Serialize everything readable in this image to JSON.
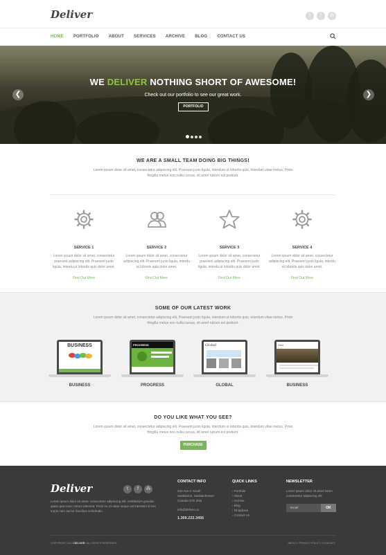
{
  "brand": {
    "logo": "Deliver",
    "accent": "#7ab55c"
  },
  "social_icons": [
    "twitter-icon",
    "facebook-icon",
    "rss-icon"
  ],
  "nav": {
    "items": [
      "HOME",
      "PORTFOLIO",
      "ABOUT",
      "SERVICES",
      "ARCHIVE",
      "BLOG",
      "CONTACT US"
    ],
    "active": "HOME"
  },
  "hero": {
    "title_pre": "WE",
    "title_accent": "DELIVER",
    "title_post": "NOTHING SHORT OF AWESOME!",
    "subtitle": "Check out our portfolio to see our great work.",
    "button": "PORTFOLIO",
    "prev": "❮",
    "next": "❯",
    "slide_count": 4,
    "current_slide": 1
  },
  "intro": {
    "title": "WE ARE A SMALL TEAM DOING BIG THINGS!",
    "text": "Lorem ipsum dolor sit amet, consectetur adipiscing elit. Praesent justo ligula, interdum ut lobortis quis, interdum vitae metus. Proin fringilla metus non nulla cursus, sit amet rutrum est pretium."
  },
  "services": [
    {
      "title": "SERVICE 1",
      "icon": "gear-icon",
      "text": "Lorem ipsum dolor sit amet, consectetur praesent adipiscing elit. Praesent justo ligula, interdu ut lobortis quis dolor amet.",
      "link": "Find Out More"
    },
    {
      "title": "SERVICE 2",
      "icon": "users-icon",
      "text": "Lorem ipsum dolor sit amet, consectetur adipiscing elit. Praesent justo ligula, interdu ut lobortis quis dolor amet.",
      "link": "Find Out More"
    },
    {
      "title": "SERVICE 3",
      "icon": "star-icon",
      "text": "Lorem ipsum dolor sit amet, consectetur praesent adipiscing elit. Praesent justo ligula, interdu ut lobortis quis dolor amet.",
      "link": "Find Out More"
    },
    {
      "title": "SERVICE 4",
      "icon": "gear-icon",
      "text": "Lorem ipsum dolor sit amet, consectetur adipiscing elit. Praesent justo ligula, interdu ut lobortis quis dolor amet.",
      "link": "Find Out More"
    }
  ],
  "work": {
    "title": "SOME OF OUR LATEST WORK",
    "text": "Lorem ipsum dolor sit amet, consectetur adipiscing elit. Praesent justo ligula, interdum ut lobortis quis, interdum vitae metus. Proin fringilla metus non nulla cursus, sit amet rutrum est pretium.",
    "items": [
      {
        "caption": "BUSINESS",
        "screen_title": "BUSINESS"
      },
      {
        "caption": "PROGRESS",
        "screen_title": "PROGRESS"
      },
      {
        "caption": "GLOBAL",
        "screen_title": "Global"
      },
      {
        "caption": "BUSINESS",
        "screen_title": "Vivo"
      }
    ]
  },
  "like": {
    "title": "DO YOU LIKE WHAT YOU SEE?",
    "text": "Lorem ipsum dolor sit amet, consectetur adipiscing elit. Praesent justo ligula, interdum ut lobortis quis, interdum vitae metus. Proin fringilla metus non nulla cursus, sit amet rutrum est pretium.",
    "button": "PURCHASE"
  },
  "footer": {
    "logo": "Deliver",
    "about": "Lorem ipsum dolor sit amet, consectetur adipiscing elit. Vestibulum gravida quam quis nunc rutrum placerat. Proin eu mi vitae neque vel interdum id nec turpis nam auctor faucibus sollicitudin.",
    "contact_title": "CONTACT INFO",
    "address": [
      "222 Ave C South",
      "Saskatoon, Saskatchewan",
      "Canada S7K 2N5"
    ],
    "email": "info@deliver.ca",
    "phone": "1.306.222.3456",
    "links_title": "QUICK LINKS",
    "links": [
      "Portfolio",
      "About",
      "Archive",
      "Blog",
      "Dropdown",
      "Contact Us"
    ],
    "newsletter_title": "NEWSLETTER",
    "newsletter_text": "Lorem ipsum dolor sit amet lorem consectetur adipiscing elit.",
    "email_placeholder": "Email",
    "ok_button": "OK",
    "copyright_pre": "COPYRIGHT 2013",
    "copyright_brand": "DELIVER",
    "copyright_post": ". ALL RIGHTS RESERVED.",
    "bottom_links": "ABOUT  /  PRIVACY POLICY  /  CONTACT"
  }
}
